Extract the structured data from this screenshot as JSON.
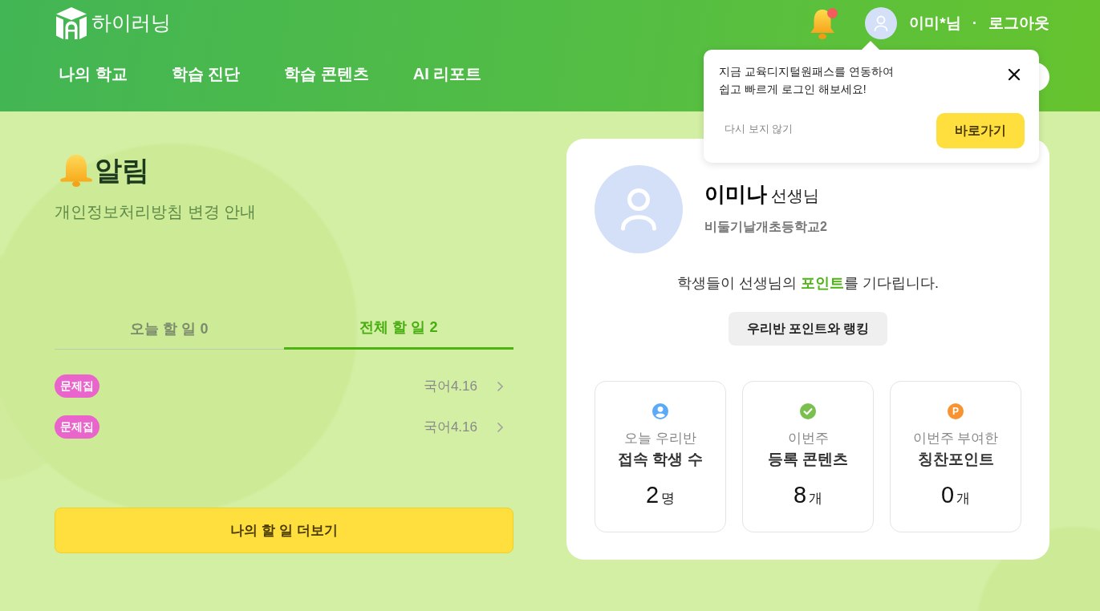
{
  "header": {
    "logo_text": "하이러닝",
    "notification_dot": true,
    "user_name": "이미*님",
    "separator": "·",
    "logout": "로그아웃",
    "nav": [
      "나의 학교",
      "학습 진단",
      "학습 콘텐츠",
      "AI 리포트"
    ]
  },
  "login_popover": {
    "message": "지금 교육디지털원패스를 연동하여\n쉽고 빠르게 로그인 해보세요!",
    "dismiss": "다시 보지 않기",
    "action": "바로가기"
  },
  "notice": {
    "title": "알림",
    "text": "개인정보처리방침 변경 안내"
  },
  "tabs": [
    {
      "label": "오늘 할 일 0",
      "selected": false
    },
    {
      "label": "전체 할 일 2",
      "selected": true
    }
  ],
  "tasks": [
    {
      "badge": "문제집",
      "subject": "국어4.16"
    },
    {
      "badge": "문제집",
      "subject": "국어4.16"
    }
  ],
  "more_button": "나의 할 일 더보기",
  "profile": {
    "name": "이미나",
    "role": "선생님",
    "school": "비둘기날개초등학교2",
    "message": "학생들이 선생님의 **포인트**를 기다립니다.",
    "button": "우리반 포인트와 랭킹"
  },
  "stats": [
    {
      "kind": "person",
      "label": "오늘 우리반",
      "title": "접속 학생 수",
      "value": "2",
      "unit": "명"
    },
    {
      "kind": "check",
      "label": "이번주",
      "title": "등록 콘텐츠",
      "value": "8",
      "unit": "개"
    },
    {
      "kind": "point",
      "icon_text": "P",
      "label": "이번주 부여한",
      "title": "칭찬포인트",
      "value": "0",
      "unit": "개"
    }
  ]
}
